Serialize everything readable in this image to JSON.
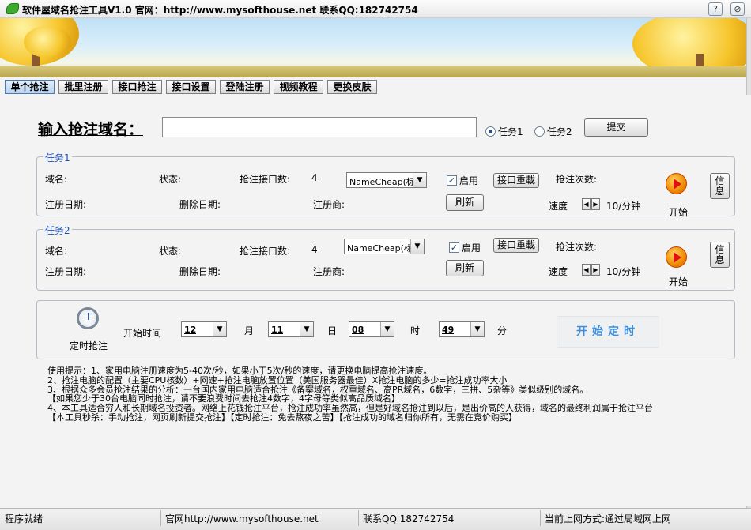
{
  "window": {
    "title": "软件屋域名抢注工具V1.0 官网：http://www.mysofthouse.net 联系QQ:182742754",
    "buttons": [
      "help-icon",
      "close-icon"
    ]
  },
  "tabs": [
    {
      "label": "单个抢注",
      "active": true
    },
    {
      "label": "批里注册",
      "active": false
    },
    {
      "label": "接口抢注",
      "active": false
    },
    {
      "label": "接口设置",
      "active": false
    },
    {
      "label": "登陆注册",
      "active": false
    },
    {
      "label": "视频教程",
      "active": false
    },
    {
      "label": "更换皮肤",
      "active": false
    }
  ],
  "form": {
    "domain_label": "输入抢注域名：",
    "domain_value": "",
    "radio1": "任务1",
    "radio2": "任务2",
    "submit": "提交"
  },
  "task1": {
    "title": "任务1",
    "domain_label": "域名:",
    "status_label": "状态:",
    "api_count_label": "抢注接口数:",
    "api_count": "4",
    "provider": "NameCheap(标准",
    "enable_label": "启用",
    "reload_label": "接口重載",
    "attempts_label": "抢注次数:",
    "reg_date_label": "注册日期:",
    "del_date_label": "删除日期:",
    "registrar_label": "注册商:",
    "refresh_label": "刷新",
    "speed_label": "速度",
    "speed_value": "10/分钟",
    "start_label": "开始",
    "info_label": "信息"
  },
  "task2": {
    "title": "任务2",
    "domain_label": "域名:",
    "status_label": "状态:",
    "api_count_label": "抢注接口数:",
    "api_count": "4",
    "provider": "NameCheap(标准",
    "enable_label": "启用",
    "reload_label": "接口重載",
    "attempts_label": "抢注次数:",
    "reg_date_label": "注册日期:",
    "del_date_label": "删除日期:",
    "registrar_label": "注册商:",
    "refresh_label": "刷新",
    "speed_label": "速度",
    "speed_value": "10/分钟",
    "start_label": "开始",
    "info_label": "信息"
  },
  "timer": {
    "label": "定时抢注",
    "start_time_label": "开始时间",
    "month": "12",
    "month_unit": "月",
    "day": "11",
    "day_unit": "日",
    "hour": "08",
    "hour_unit": "时",
    "minute": "49",
    "minute_unit": "分",
    "start_button": "开始定时"
  },
  "tips": [
    "使用提示：1、家用电脑注册速度为5-40次/秒，如果小于5次/秒的速度，请更换电脑提高抢注速度。",
    "2、抢注电脑的配置（主要CPU核数）+网速+抢注电脑放置位置（美国服务器最佳）X抢注电脑的多少=抢注成功率大小",
    "3、根据众多会员抢注结果的分析：一台国内家用电脑适合抢注《备案域名，权重域名、高PR域名，6数字，三拼、5杂等》类似级别的域名。",
    "【如果您少于30台电脑同时抢注，请不要浪费时间去抢注4数字，4字母等类似高品质域名】",
    "4、本工具适合穷人和长期域名投资者。网络上花钱抢注平台，抢注成功率虽然高，但是好域名抢注到以后，是出价高的人获得，域名的最终利润属于抢注平台",
    "【本工具秒杀：手动抢注，网页刷新提交抢注】【定时抢注：免去熬夜之苦】【抢注成功的域名归你所有，无需在竞价购买】"
  ],
  "status": {
    "ready": "程序就绪",
    "site": "官网http://www.mysofthouse.net",
    "qq": "联系QQ 182742754",
    "net": "当前上网方式:通过局域网上网"
  }
}
